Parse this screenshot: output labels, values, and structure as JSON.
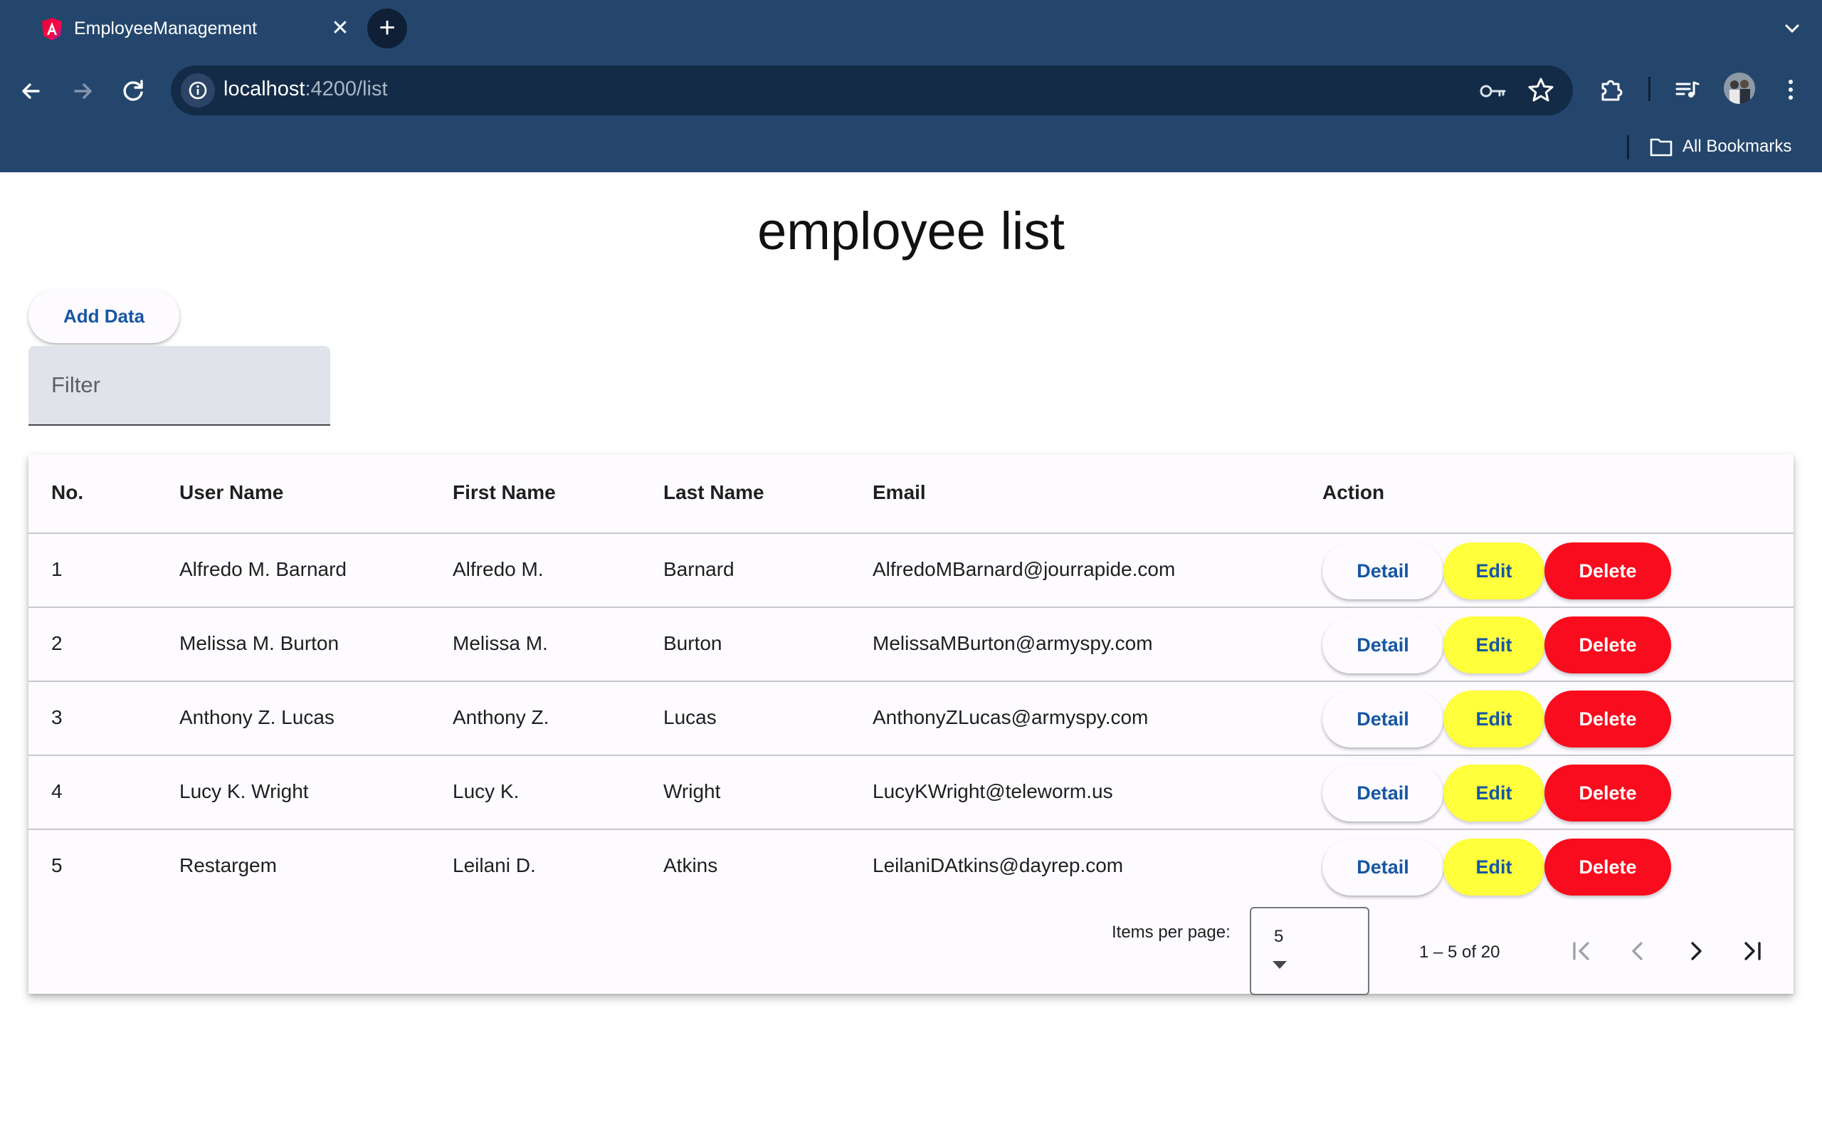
{
  "browser": {
    "tab_title": "EmployeeManagement",
    "url_host": "localhost",
    "url_path": ":4200/list",
    "bookmarks_label": "All Bookmarks"
  },
  "page": {
    "title": "employee list",
    "add_button": "Add Data",
    "filter_placeholder": "Filter"
  },
  "table": {
    "headers": {
      "no": "No.",
      "user_name": "User Name",
      "first_name": "First Name",
      "last_name": "Last Name",
      "email": "Email",
      "action": "Action"
    },
    "rows": [
      {
        "no": "1",
        "user_name": "Alfredo M. Barnard",
        "first_name": "Alfredo M.",
        "last_name": "Barnard",
        "email": "AlfredoMBarnard@jourrapide.com"
      },
      {
        "no": "2",
        "user_name": "Melissa M. Burton",
        "first_name": "Melissa M.",
        "last_name": "Burton",
        "email": "MelissaMBurton@armyspy.com"
      },
      {
        "no": "3",
        "user_name": "Anthony Z. Lucas",
        "first_name": "Anthony Z.",
        "last_name": "Lucas",
        "email": "AnthonyZLucas@armyspy.com"
      },
      {
        "no": "4",
        "user_name": "Lucy K. Wright",
        "first_name": "Lucy K.",
        "last_name": "Wright",
        "email": "LucyKWright@teleworm.us"
      },
      {
        "no": "5",
        "user_name": "Restargem",
        "first_name": "Leilani D.",
        "last_name": "Atkins",
        "email": "LeilaniDAtkins@dayrep.com"
      }
    ],
    "actions": {
      "detail": "Detail",
      "edit": "Edit",
      "delete": "Delete"
    }
  },
  "paginator": {
    "items_per_page_label": "Items per page:",
    "page_size": "5",
    "range_label": "1 – 5 of 20"
  },
  "colors": {
    "chrome_bg": "#24466d",
    "omnibox_bg": "#132b47",
    "primary_text": "#1656a4",
    "edit_bg": "#ffff3b",
    "delete_bg": "#f80c1d"
  },
  "icons": [
    "angular-favicon-icon",
    "close-icon",
    "plus-icon",
    "chevron-down-icon",
    "back-arrow-icon",
    "forward-arrow-icon",
    "reload-icon",
    "site-info-icon",
    "password-key-icon",
    "star-icon",
    "extensions-icon",
    "media-queue-icon",
    "avatar",
    "menu-kebab-icon",
    "folder-icon",
    "first-page-icon",
    "prev-page-icon",
    "next-page-icon",
    "last-page-icon",
    "dropdown-arrow-icon"
  ]
}
